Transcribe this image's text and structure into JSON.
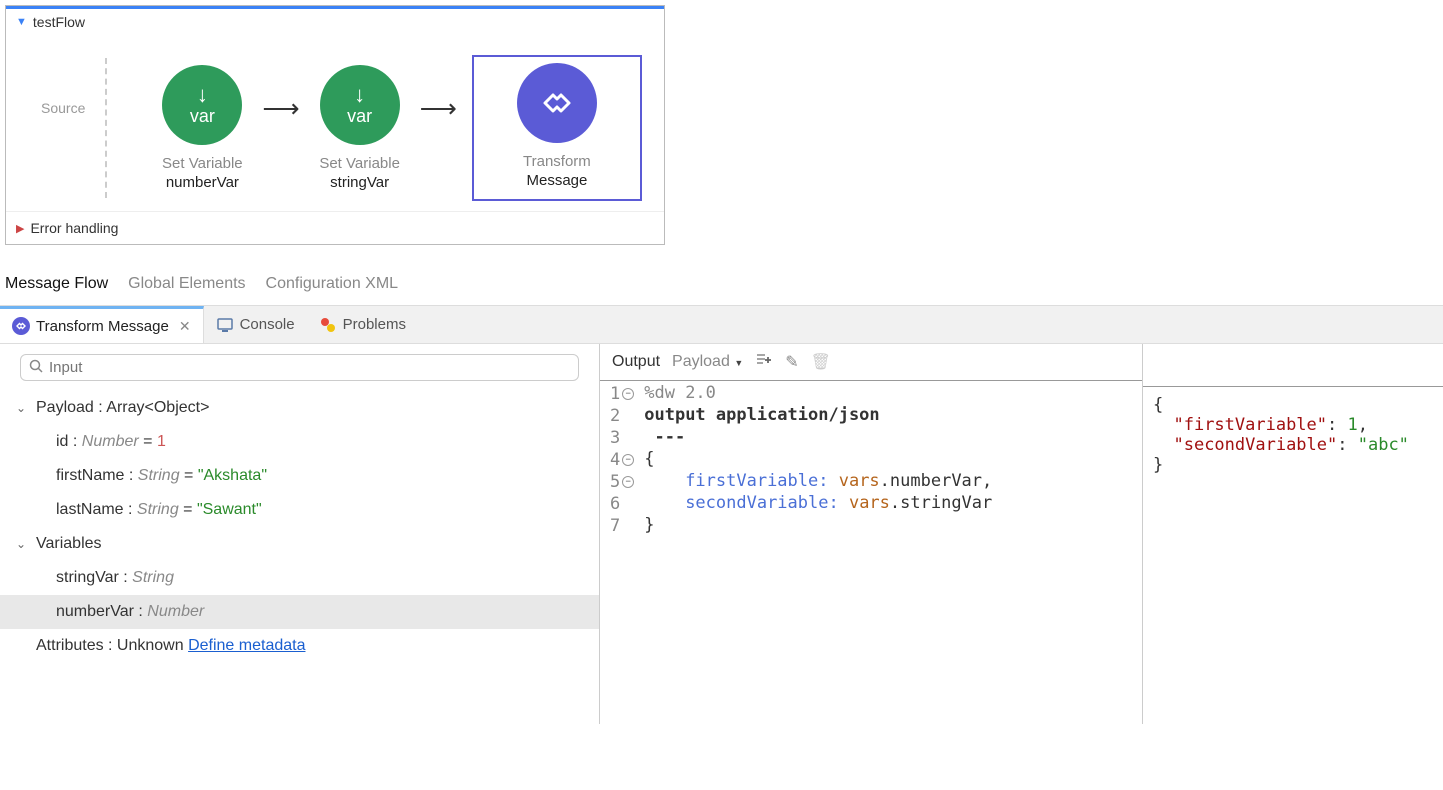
{
  "flow": {
    "name": "testFlow",
    "source_label": "Source",
    "nodes": [
      {
        "type": "var",
        "label": "Set Variable",
        "name": "numberVar"
      },
      {
        "type": "var",
        "label": "Set Variable",
        "name": "stringVar"
      },
      {
        "type": "transform",
        "label": "Transform",
        "name": "Message"
      }
    ],
    "error_section": "Error handling"
  },
  "editor_tabs": {
    "message_flow": "Message Flow",
    "global_elements": "Global Elements",
    "config_xml": "Configuration XML"
  },
  "panel_tabs": {
    "transform": "Transform Message",
    "console": "Console",
    "problems": "Problems"
  },
  "input_panel": {
    "search_placeholder": "Input",
    "payload": {
      "label": "Payload : ",
      "type": "Array<Object>",
      "id": {
        "name": "id : ",
        "type": "Number",
        "eq": " = ",
        "value": "1"
      },
      "firstName": {
        "name": "firstName : ",
        "type": "String",
        "eq": " = ",
        "value": "\"Akshata\""
      },
      "lastName": {
        "name": "lastName : ",
        "type": "String",
        "eq": " = ",
        "value": "\"Sawant\""
      }
    },
    "variables": {
      "label": "Variables",
      "items": [
        {
          "name": "stringVar : ",
          "type": "String"
        },
        {
          "name": "numberVar : ",
          "type": "Number"
        }
      ]
    },
    "attributes": {
      "label": "Attributes : Unknown ",
      "link": "Define metadata"
    }
  },
  "output_panel": {
    "label": "Output",
    "target": "Payload",
    "code": {
      "l1": "%dw 2.0",
      "l2": "output application/json",
      "l3": " ---",
      "l4": "{",
      "l5a": "    firstVariable: ",
      "l5b": "vars",
      "l5c": ".numberVar,",
      "l6a": "    secondVariable: ",
      "l6b": "vars",
      "l6c": ".stringVar",
      "l7": "}"
    }
  },
  "preview": {
    "open": "{",
    "k1": "\"firstVariable\"",
    "v1": "1",
    "k2": "\"secondVariable\"",
    "v2": "\"abc\"",
    "close": "}"
  }
}
